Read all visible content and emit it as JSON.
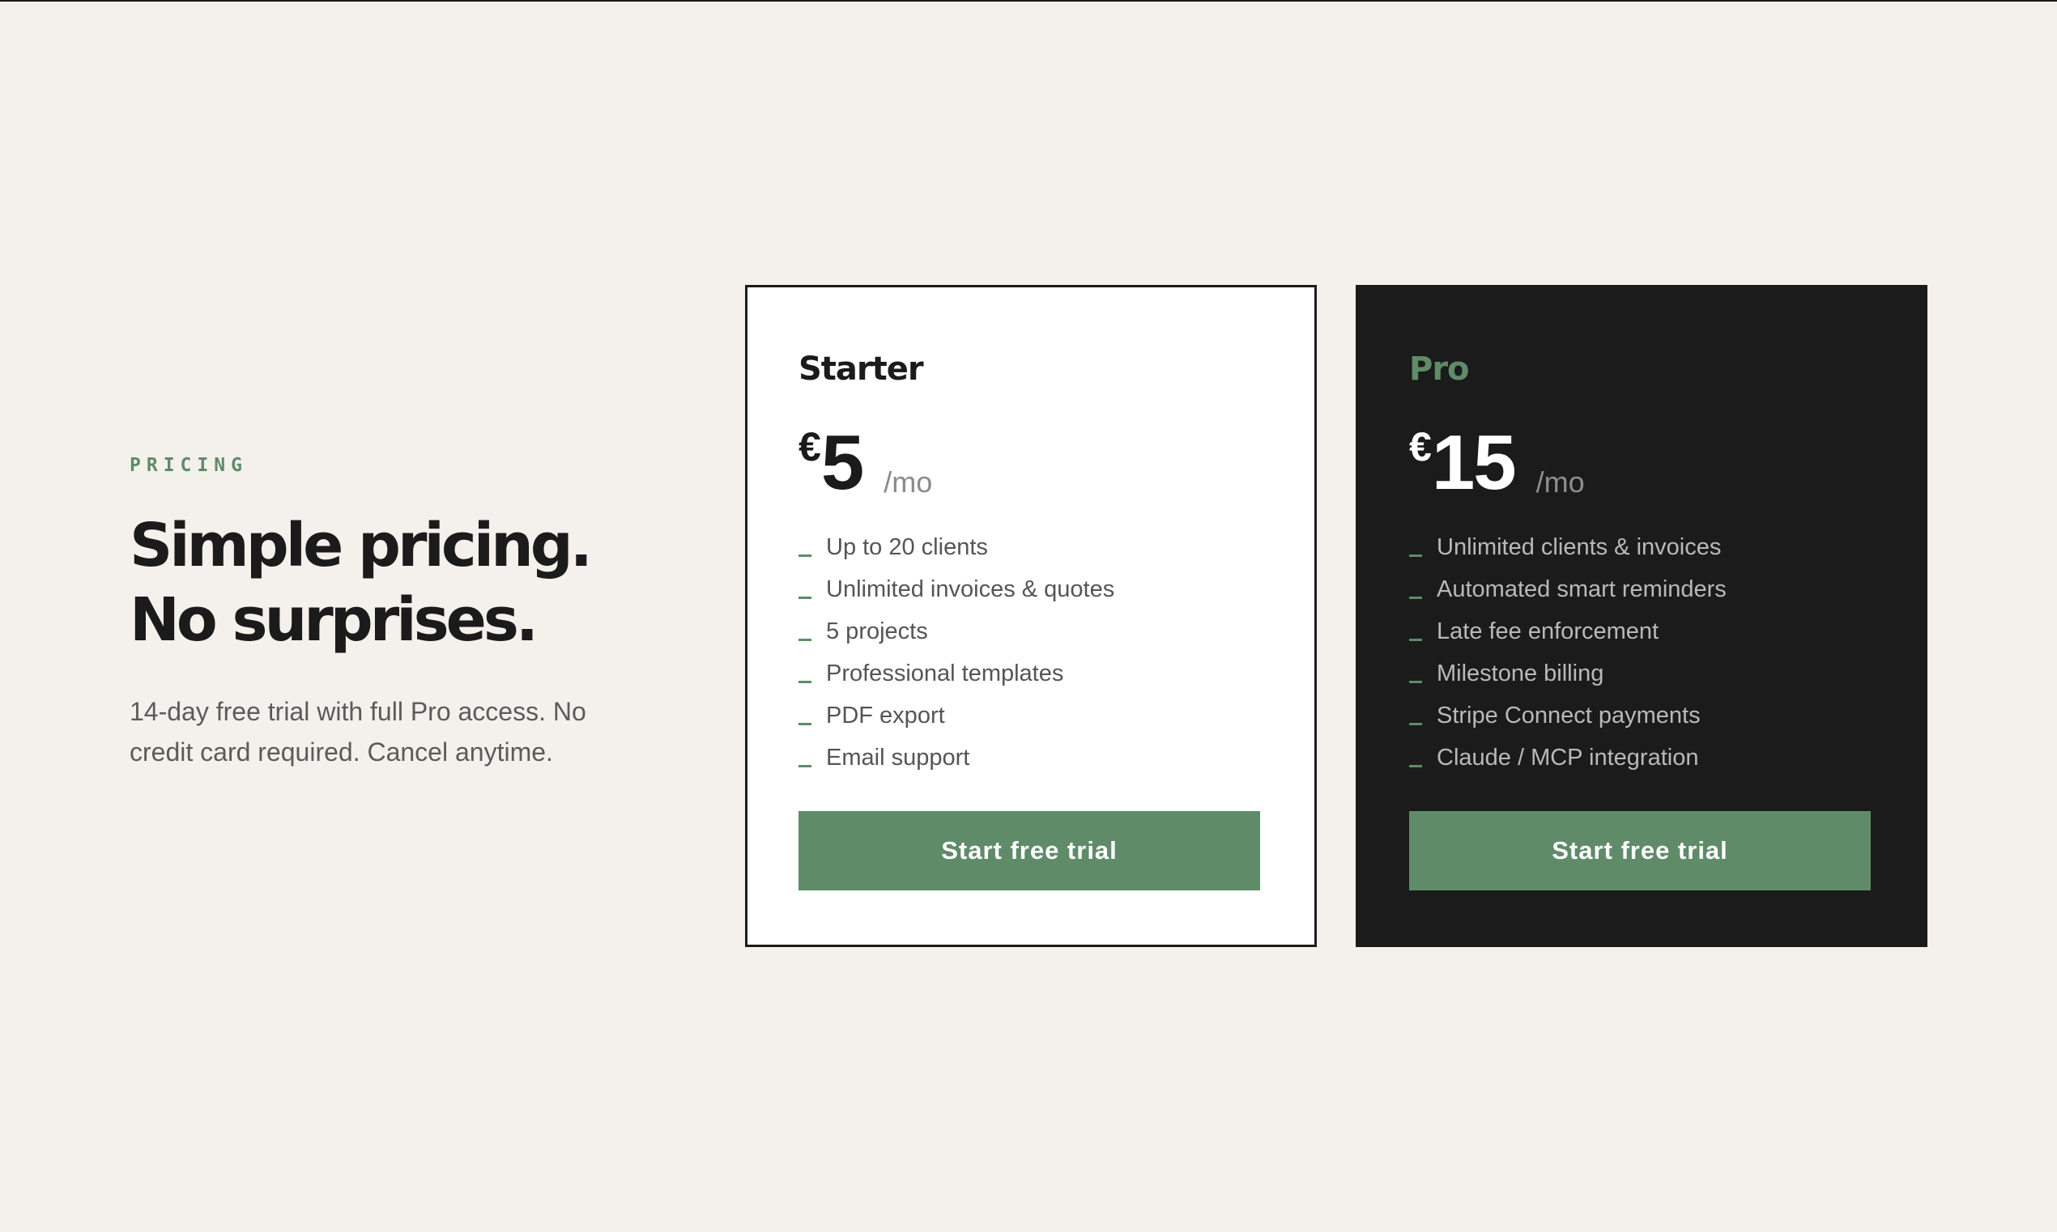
{
  "intro": {
    "eyebrow": "PRICING",
    "headline_line1": "Simple pricing.",
    "headline_line2": "No surprises.",
    "subtext": "14-day free trial with full Pro access. No credit card required. Cancel anytime."
  },
  "plans": [
    {
      "name": "Starter",
      "currency": "€",
      "amount": "5",
      "period": "/mo",
      "features": [
        "Up to 20 clients",
        "Unlimited invoices & quotes",
        "5 projects",
        "Professional templates",
        "PDF export",
        "Email support"
      ],
      "cta": "Start free trial"
    },
    {
      "name": "Pro",
      "currency": "€",
      "amount": "15",
      "period": "/mo",
      "features": [
        "Unlimited clients & invoices",
        "Automated smart reminders",
        "Late fee enforcement",
        "Milestone billing",
        "Stripe Connect payments",
        "Claude / MCP integration"
      ],
      "cta": "Start free trial"
    }
  ],
  "colors": {
    "background": "#f4f1ec",
    "accent_green": "#5f8b69",
    "dark": "#1b1b1b",
    "card_light": "#ffffff"
  }
}
